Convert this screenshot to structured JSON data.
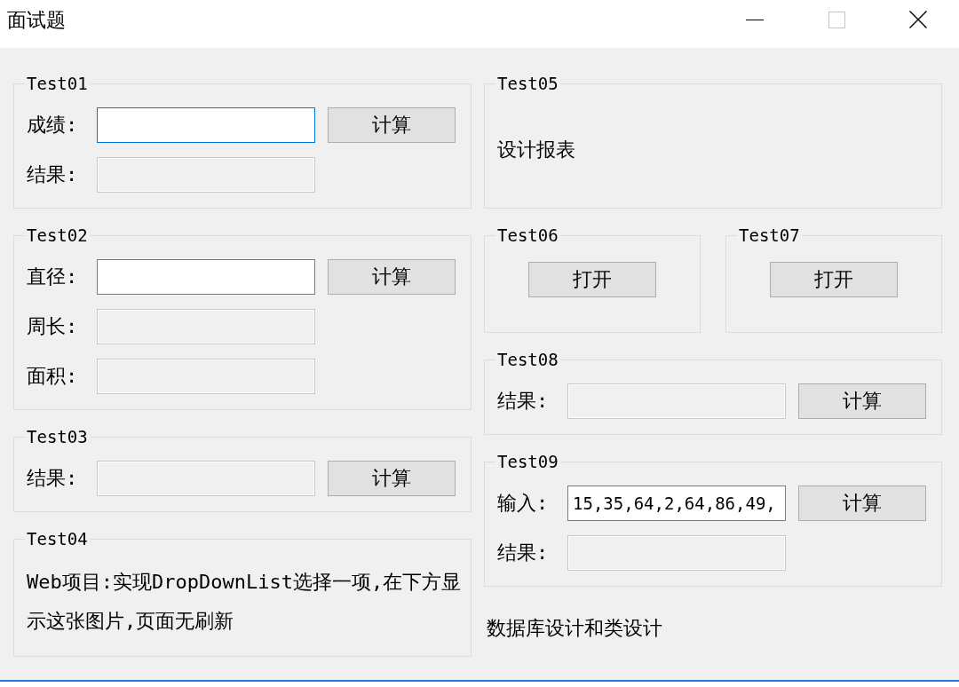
{
  "window": {
    "title": "面试题",
    "controls": [
      {
        "kind": "minimize",
        "disabled": false
      },
      {
        "kind": "maximize",
        "disabled": true
      },
      {
        "kind": "close",
        "disabled": false
      }
    ]
  },
  "columns": [
    {
      "blocks": [
        {
          "kind": "group",
          "title": "Test01",
          "rows": [
            {
              "kind": "field",
              "label": "成绩:",
              "focused": true,
              "disabled": false,
              "button": "计算"
            },
            {
              "kind": "field",
              "label": "结果:",
              "focused": false,
              "disabled": true
            }
          ]
        },
        {
          "kind": "group",
          "title": "Test02",
          "rows": [
            {
              "kind": "field",
              "label": "直径:",
              "focused": false,
              "disabled": false,
              "button": "计算"
            },
            {
              "kind": "field",
              "label": "周长:",
              "focused": false,
              "disabled": true
            },
            {
              "kind": "field",
              "label": "面积:",
              "focused": false,
              "disabled": true
            }
          ]
        },
        {
          "kind": "group",
          "title": "Test03",
          "rows": [
            {
              "kind": "field",
              "label": "结果:",
              "focused": false,
              "disabled": true,
              "button": "计算"
            }
          ]
        },
        {
          "kind": "group",
          "title": "Test04",
          "rows": [
            {
              "kind": "text",
              "text": "Web项目:实现DropDownList选择一项,在下方显示这张图片,页面无刷新"
            }
          ]
        }
      ]
    },
    {
      "blocks": [
        {
          "kind": "group",
          "title": "Test05",
          "rows": [
            {
              "kind": "text",
              "text": "设计报表"
            }
          ]
        },
        {
          "kind": "group_row",
          "groups": [
            {
              "title": "Test06",
              "rows": [
                {
                  "kind": "button",
                  "button": "打开"
                }
              ]
            },
            {
              "title": "Test07",
              "rows": [
                {
                  "kind": "button",
                  "button": "打开"
                }
              ]
            }
          ]
        },
        {
          "kind": "group",
          "title": "Test08",
          "rows": [
            {
              "kind": "field",
              "label": "结果:",
              "focused": false,
              "disabled": true,
              "button": "计算"
            }
          ]
        },
        {
          "kind": "group",
          "title": "Test09",
          "rows": [
            {
              "kind": "field",
              "label": "输入:",
              "value": "15,35,64,2,64,86,49,",
              "focused": false,
              "disabled": false,
              "button": "计算"
            },
            {
              "kind": "field",
              "label": "结果:",
              "focused": false,
              "disabled": true
            }
          ]
        },
        {
          "kind": "note",
          "text": "数据库设计和类设计"
        }
      ]
    }
  ]
}
